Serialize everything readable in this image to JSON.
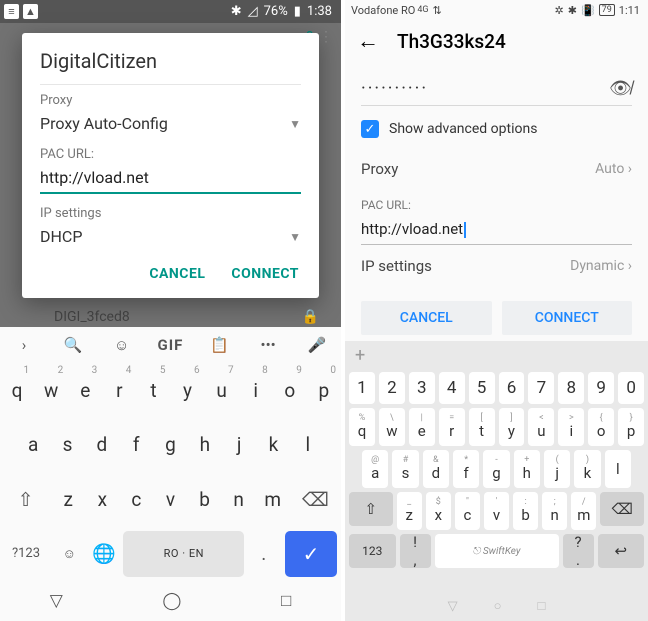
{
  "left": {
    "status": {
      "battery": "76%",
      "time": "1:38"
    },
    "dialog": {
      "title": "DigitalCitizen",
      "proxy_label": "Proxy",
      "proxy_value": "Proxy Auto-Config",
      "pac_label": "PAC URL:",
      "pac_value": "http://vload.net",
      "ip_label": "IP settings",
      "ip_value": "DHCP",
      "cancel": "CANCEL",
      "connect": "CONNECT"
    },
    "wifi_behind": "DIGI_3fced8",
    "keyboard": {
      "gif": "GIF",
      "row1": [
        "q",
        "w",
        "e",
        "r",
        "t",
        "y",
        "u",
        "i",
        "o",
        "p"
      ],
      "sup1": [
        "1",
        "2",
        "3",
        "4",
        "5",
        "6",
        "7",
        "8",
        "9",
        "0"
      ],
      "row2": [
        "a",
        "s",
        "d",
        "f",
        "g",
        "h",
        "j",
        "k",
        "l"
      ],
      "row3": [
        "z",
        "x",
        "c",
        "v",
        "b",
        "n",
        "m"
      ],
      "sym": "?123",
      "lang": "RO · EN",
      "dot": "."
    }
  },
  "right": {
    "status": {
      "carrier": "Vodafone RO",
      "time": "1:11",
      "battery": "79"
    },
    "title": "Th3G33ks24",
    "password_dots": "··········",
    "show_adv": "Show advanced options",
    "proxy_label": "Proxy",
    "proxy_value": "Auto",
    "pac_label": "PAC URL:",
    "pac_value": "http://vload.net",
    "ip_label": "IP settings",
    "ip_value": "Dynamic",
    "cancel": "CANCEL",
    "connect": "CONNECT",
    "keyboard": {
      "nums": [
        "1",
        "2",
        "3",
        "4",
        "5",
        "6",
        "7",
        "8",
        "9",
        "0"
      ],
      "row1": [
        "q",
        "w",
        "e",
        "r",
        "t",
        "y",
        "u",
        "i",
        "o",
        "p"
      ],
      "sup1": [
        "%",
        "\\",
        "|",
        "=",
        "[",
        "]",
        "<",
        ">",
        "{",
        "}"
      ],
      "row2": [
        "a",
        "s",
        "d",
        "f",
        "g",
        "h",
        "j",
        "k",
        "l"
      ],
      "sup2": [
        "@",
        "#",
        "&",
        "*",
        "-",
        "+",
        "(",
        ")",
        ""
      ],
      "row3": [
        "z",
        "x",
        "c",
        "v",
        "b",
        "n",
        "m"
      ],
      "sup3": [
        "_",
        "$",
        "\"",
        "'",
        ":",
        ";",
        "/"
      ],
      "fn123": "123",
      "swift": "SwiftKey",
      "comma": ",",
      "dot": ".",
      "excl": "!",
      "ques": "?"
    }
  }
}
